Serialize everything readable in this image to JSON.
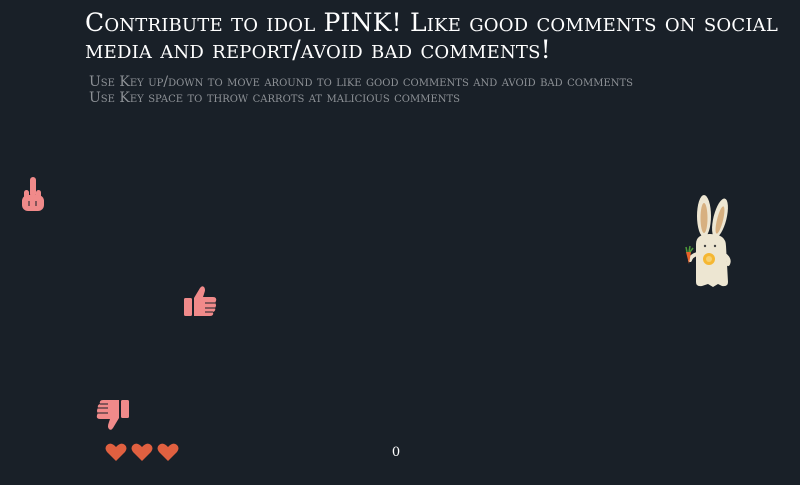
{
  "game": {
    "title": "Contribute to idol PINK! Like good comments on social media and report/avoid bad comments!",
    "instructions": [
      "Use Key up/down to move around to like good comments and avoid bad comments",
      "Use Key space to throw carrots at malicious comments"
    ],
    "score": "0",
    "lives": 3,
    "player": {
      "name": "bunny-player",
      "icon": "rabbit-with-carrot"
    },
    "enemies": [
      {
        "kind": "bad-comment",
        "icon": "middle-finger-icon"
      },
      {
        "kind": "good-comment",
        "icon": "thumbs-up-icon"
      },
      {
        "kind": "bad-comment",
        "icon": "thumbs-down-icon"
      }
    ]
  },
  "colors": {
    "background": "#192028",
    "title": "#ffffff",
    "instructions": "#8d9196",
    "hand": "#f08a8a",
    "heart": "#e06040",
    "bunny": "#ede6d2",
    "bunny_ear_inner": "#d7b080",
    "carrot": "#e8632a",
    "bunny_belly": "#f5b732"
  }
}
